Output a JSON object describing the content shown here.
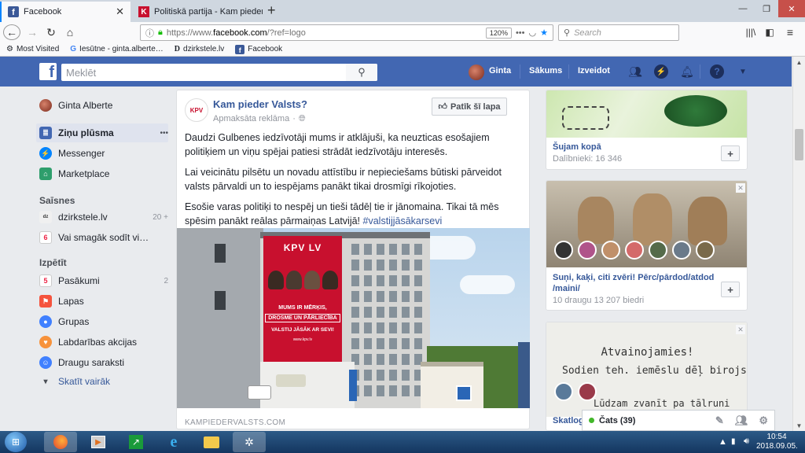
{
  "browser": {
    "tabs": [
      {
        "title": "Facebook",
        "active": true
      },
      {
        "title": "Politiskā partija - Kam pieder v…",
        "active": false
      }
    ],
    "new_tab": "+",
    "window_controls": [
      "—",
      "❐",
      "✕"
    ],
    "url_prefix": "https://www.",
    "url_domain": "facebook.com",
    "url_rest": "/?ref=logo",
    "zoom": "120%",
    "search_placeholder": "Search",
    "bookmarks": [
      "Most Visited",
      "Iesūtne - ginta.alberte…",
      "dzirkstele.lv",
      "Facebook"
    ]
  },
  "fb_header": {
    "search_placeholder": "Meklēt",
    "user_name": "Ginta",
    "home_label": "Sākums",
    "create_label": "Izveidot"
  },
  "left_nav": {
    "profile_name": "Ginta Alberte",
    "items": [
      {
        "label": "Ziņu plūsma",
        "more": "•••"
      },
      {
        "label": "Messenger"
      },
      {
        "label": "Marketplace"
      }
    ],
    "shortcuts_title": "Saīsnes",
    "shortcuts": [
      {
        "label": "dzirkstele.lv",
        "count": "20 +"
      },
      {
        "label": "Vai smagāk sodīt vi…"
      }
    ],
    "explore_title": "Izpētīt",
    "explore": [
      {
        "label": "Pasākumi",
        "count": "2"
      },
      {
        "label": "Lapas"
      },
      {
        "label": "Grupas"
      },
      {
        "label": "Labdarības akcijas"
      },
      {
        "label": "Draugu saraksti"
      },
      {
        "label": "Skatīt vairāk"
      }
    ]
  },
  "post": {
    "page_name": "Kam pieder Valsts?",
    "sponsored": "Apmaksāta reklāma",
    "like_page": "Patīk šī lapa",
    "p1": "Daudzi Gulbenes iedzīvotāji mums ir atklājuši, ka neuzticas esošajiem politiķiem un viņu spējai patiesi strādāt iedzīvotāju interesēs.",
    "p2": "Lai veicinātu pilsētu un novadu attīstību ir nepieciešams būtiski pārveidot valsts pārvaldi un to iespējams panākt tikai drosmīgi rīkojoties.",
    "p3": "Esošie varas politiķi to nespēj un tieši tādēļ tie ir jānomaina. Tikai tā mēs spēsim panākt reālas pārmaiņas Latvijā!",
    "hashtag": "#valstijjāsākarsevi",
    "banner_logo": "KPV LV",
    "banner_line1": "MUMS IR MĒRĶIS,",
    "banner_line2": "DROSME UN PĀRLIECĪBA",
    "banner_line3": "VALSTIJ JĀSĀK AR SEVI!",
    "banner_url": "www.kpv.lv",
    "link_domain": "KAMPIEDERVALSTS.COM"
  },
  "right_cards": [
    {
      "title": "Šujam kopā",
      "sub": "Dalībnieki: 16 346"
    },
    {
      "title": "Suņi, kaķi, citi zvēri! Pērc/pārdod/atdod /maini/",
      "sub": "10 draugu 13 207 biedri"
    },
    {
      "title": "Skatlog",
      "sign1": "Atvainojamies!",
      "sign2": "Šodien teh. iemēslu dēļ birojs ir",
      "sign3": "Lūdzam zvanīt pa tālruni"
    }
  ],
  "chat": {
    "label": "Čats (39)"
  },
  "taskbar": {
    "time": "10:54",
    "date": "2018.09.05."
  },
  "colors": {
    "fb_blue": "#4267b2",
    "link": "#365899",
    "online": "#42b72a"
  }
}
